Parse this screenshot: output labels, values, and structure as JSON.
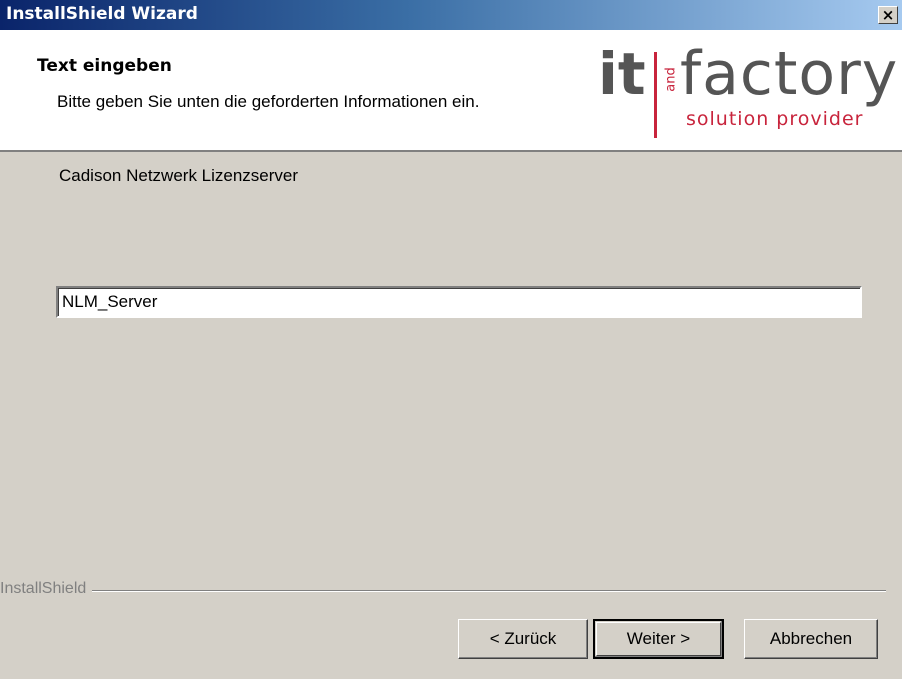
{
  "window": {
    "title": "InstallShield Wizard",
    "close_glyph": "×",
    "close_icon": "close-icon"
  },
  "header": {
    "title": "Text eingeben",
    "subtitle": "Bitte geben Sie unten die geforderten Informationen ein."
  },
  "logo": {
    "it": "it",
    "and": "and",
    "factory": "factory",
    "tagline": "solution provider",
    "brand_color": "#c8243c"
  },
  "main": {
    "prompt_label": "Cadison Netzwerk Lizenzserver",
    "input_value": "NLM_Server"
  },
  "footer": {
    "brand_label": "InstallShield",
    "back_button": "< Zurück",
    "next_button": "Weiter >",
    "cancel_button": "Abbrechen"
  },
  "colors": {
    "titlebar_start": "#0a246a",
    "titlebar_end": "#a6caf0",
    "dialog_bg": "#d4d0c8"
  }
}
